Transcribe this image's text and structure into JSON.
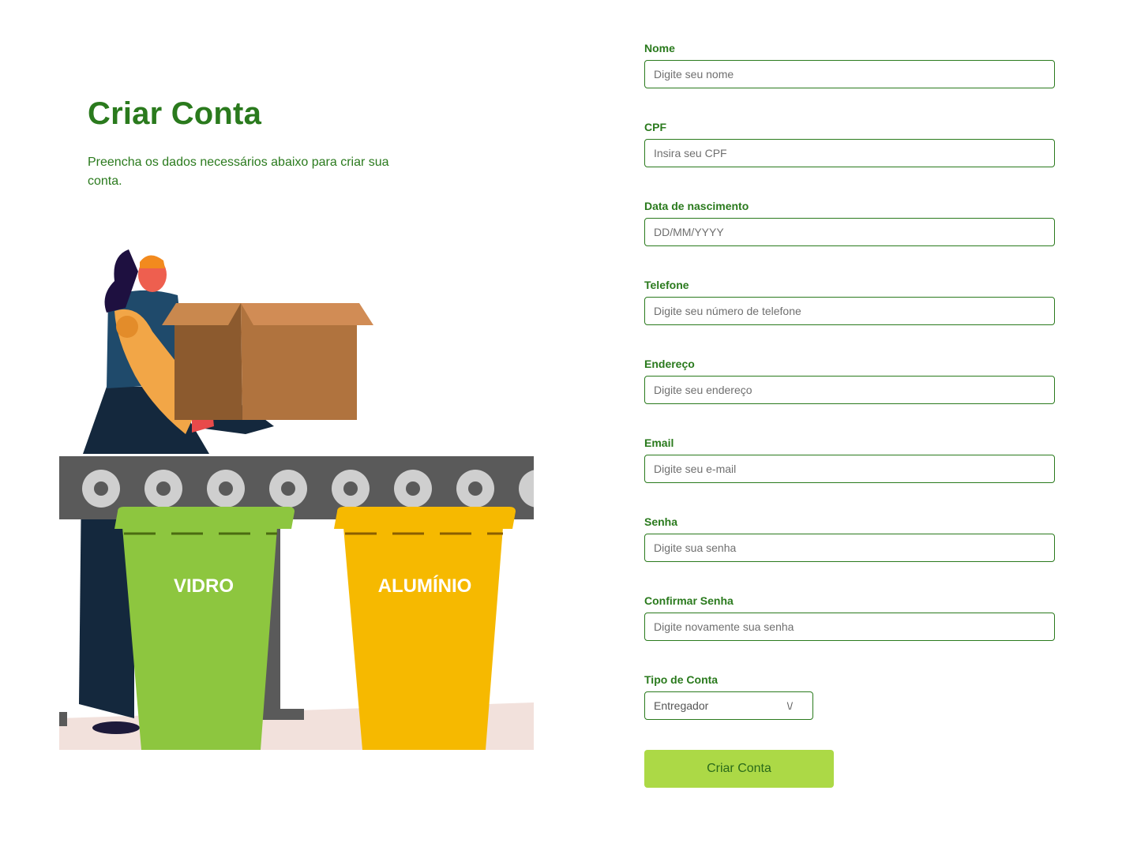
{
  "header": {
    "title": "Criar Conta",
    "subtitle": "Preencha os dados necessários abaixo para criar sua conta."
  },
  "illustration": {
    "bin_green_label": "VIDRO",
    "bin_yellow_label": "ALUMÍNIO",
    "colors": {
      "green_bin": "#8dc63f",
      "yellow_bin": "#f6b900",
      "conveyor": "#5a5a5a",
      "box": "#b0733e"
    }
  },
  "form": {
    "fields": [
      {
        "label": "Nome",
        "placeholder": "Digite seu nome"
      },
      {
        "label": "CPF",
        "placeholder": "Insira seu CPF"
      },
      {
        "label": "Data de nascimento",
        "placeholder": "DD/MM/YYYY"
      },
      {
        "label": "Telefone",
        "placeholder": "Digite seu número de telefone"
      },
      {
        "label": "Endereço",
        "placeholder": "Digite seu endereço"
      },
      {
        "label": "Email",
        "placeholder": "Digite seu e-mail"
      },
      {
        "label": "Senha",
        "placeholder": "Digite sua senha"
      },
      {
        "label": "Confirmar Senha",
        "placeholder": "Digite novamente sua senha"
      }
    ],
    "account_type": {
      "label": "Tipo de Conta",
      "value": "Entregador",
      "arrow": "\\/"
    },
    "submit_label": "Criar Conta"
  },
  "colors": {
    "primary": "#2a7a1d",
    "button": "#acd946"
  }
}
